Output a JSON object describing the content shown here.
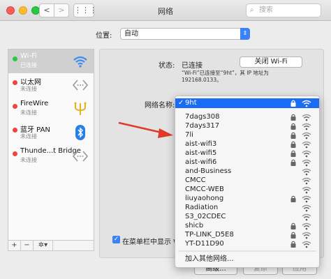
{
  "window": {
    "title": "网络",
    "search_placeholder": "搜索",
    "nav_back": "<",
    "nav_forward": ">",
    "grid": "⋮⋮⋮"
  },
  "location": {
    "label": "位置:",
    "value": "自动"
  },
  "sidebar": {
    "items": [
      {
        "name": "Wi-Fi",
        "status": "已连接",
        "dot": "#28c940",
        "icon": "wifi-icon",
        "selected": true
      },
      {
        "name": "以太网",
        "status": "未连接",
        "dot": "#ef4444",
        "icon": "ethernet-arrows-icon",
        "selected": false
      },
      {
        "name": "FireWire",
        "status": "未连接",
        "dot": "#ef4444",
        "icon": "firewire-icon",
        "selected": false
      },
      {
        "name": "蓝牙 PAN",
        "status": "未连接",
        "dot": "#ef4444",
        "icon": "bluetooth-icon",
        "selected": false
      },
      {
        "name": "Thunde...t Bridge",
        "status": "未连接",
        "dot": "#ef4444",
        "icon": "thunderbolt-arrows-icon",
        "selected": false
      }
    ],
    "footer": {
      "add": "+",
      "remove": "−",
      "gear": "✲▾"
    }
  },
  "detail": {
    "status_label": "状态:",
    "status_value": "已连接",
    "wifi_off_button": "关闭 Wi-Fi",
    "status_desc_line1": "“Wi-Fi”已连接至“9ht”，其 IP 地址为",
    "status_desc_line2": "192168.0133。",
    "network_name_label": "网络名称:",
    "show_in_menubar": "在菜单栏中显示 W",
    "advanced_button": "高级...",
    "revert_button": "复原",
    "apply_button": "应用"
  },
  "network_menu": {
    "selected": {
      "label": "9ht",
      "check": "✓",
      "locked": true
    },
    "networks": [
      {
        "label": "7dags308",
        "locked": true
      },
      {
        "label": "7days317",
        "locked": true
      },
      {
        "label": "7li",
        "locked": true
      },
      {
        "label": "aist-wifi3",
        "locked": true
      },
      {
        "label": "aist-wifi5",
        "locked": true
      },
      {
        "label": "aist-wifi6",
        "locked": true
      },
      {
        "label": "and-Business",
        "locked": false
      },
      {
        "label": "CMCC",
        "locked": false
      },
      {
        "label": "CMCC-WEB",
        "locked": false
      },
      {
        "label": "liuyaohong",
        "locked": true
      },
      {
        "label": "Radiation",
        "locked": false
      },
      {
        "label": "S3_02CDEC",
        "locked": false
      },
      {
        "label": "shicb",
        "locked": true
      },
      {
        "label": "TP-LINK_D5E8",
        "locked": true
      },
      {
        "label": "YT-D11D90",
        "locked": true
      }
    ],
    "join_other": "加入其他网络..."
  },
  "colors": {
    "accent": "#1a6cf4",
    "connected": "#28c940",
    "disconnected": "#ef4444",
    "arrow": "#e03a2a"
  }
}
